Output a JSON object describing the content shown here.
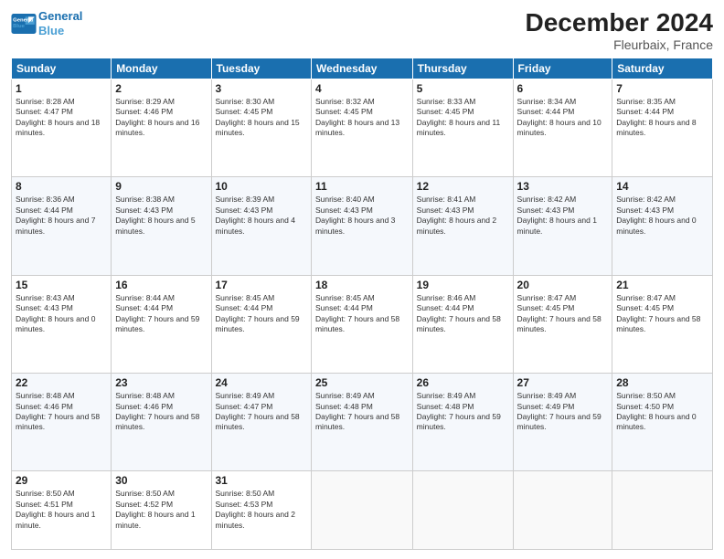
{
  "header": {
    "logo_line1": "General",
    "logo_line2": "Blue",
    "title": "December 2024",
    "subtitle": "Fleurbaix, France"
  },
  "columns": [
    "Sunday",
    "Monday",
    "Tuesday",
    "Wednesday",
    "Thursday",
    "Friday",
    "Saturday"
  ],
  "weeks": [
    [
      {
        "day": "1",
        "sunrise": "Sunrise: 8:28 AM",
        "sunset": "Sunset: 4:47 PM",
        "daylight": "Daylight: 8 hours and 18 minutes."
      },
      {
        "day": "2",
        "sunrise": "Sunrise: 8:29 AM",
        "sunset": "Sunset: 4:46 PM",
        "daylight": "Daylight: 8 hours and 16 minutes."
      },
      {
        "day": "3",
        "sunrise": "Sunrise: 8:30 AM",
        "sunset": "Sunset: 4:45 PM",
        "daylight": "Daylight: 8 hours and 15 minutes."
      },
      {
        "day": "4",
        "sunrise": "Sunrise: 8:32 AM",
        "sunset": "Sunset: 4:45 PM",
        "daylight": "Daylight: 8 hours and 13 minutes."
      },
      {
        "day": "5",
        "sunrise": "Sunrise: 8:33 AM",
        "sunset": "Sunset: 4:45 PM",
        "daylight": "Daylight: 8 hours and 11 minutes."
      },
      {
        "day": "6",
        "sunrise": "Sunrise: 8:34 AM",
        "sunset": "Sunset: 4:44 PM",
        "daylight": "Daylight: 8 hours and 10 minutes."
      },
      {
        "day": "7",
        "sunrise": "Sunrise: 8:35 AM",
        "sunset": "Sunset: 4:44 PM",
        "daylight": "Daylight: 8 hours and 8 minutes."
      }
    ],
    [
      {
        "day": "8",
        "sunrise": "Sunrise: 8:36 AM",
        "sunset": "Sunset: 4:44 PM",
        "daylight": "Daylight: 8 hours and 7 minutes."
      },
      {
        "day": "9",
        "sunrise": "Sunrise: 8:38 AM",
        "sunset": "Sunset: 4:43 PM",
        "daylight": "Daylight: 8 hours and 5 minutes."
      },
      {
        "day": "10",
        "sunrise": "Sunrise: 8:39 AM",
        "sunset": "Sunset: 4:43 PM",
        "daylight": "Daylight: 8 hours and 4 minutes."
      },
      {
        "day": "11",
        "sunrise": "Sunrise: 8:40 AM",
        "sunset": "Sunset: 4:43 PM",
        "daylight": "Daylight: 8 hours and 3 minutes."
      },
      {
        "day": "12",
        "sunrise": "Sunrise: 8:41 AM",
        "sunset": "Sunset: 4:43 PM",
        "daylight": "Daylight: 8 hours and 2 minutes."
      },
      {
        "day": "13",
        "sunrise": "Sunrise: 8:42 AM",
        "sunset": "Sunset: 4:43 PM",
        "daylight": "Daylight: 8 hours and 1 minute."
      },
      {
        "day": "14",
        "sunrise": "Sunrise: 8:42 AM",
        "sunset": "Sunset: 4:43 PM",
        "daylight": "Daylight: 8 hours and 0 minutes."
      }
    ],
    [
      {
        "day": "15",
        "sunrise": "Sunrise: 8:43 AM",
        "sunset": "Sunset: 4:43 PM",
        "daylight": "Daylight: 8 hours and 0 minutes."
      },
      {
        "day": "16",
        "sunrise": "Sunrise: 8:44 AM",
        "sunset": "Sunset: 4:44 PM",
        "daylight": "Daylight: 7 hours and 59 minutes."
      },
      {
        "day": "17",
        "sunrise": "Sunrise: 8:45 AM",
        "sunset": "Sunset: 4:44 PM",
        "daylight": "Daylight: 7 hours and 59 minutes."
      },
      {
        "day": "18",
        "sunrise": "Sunrise: 8:45 AM",
        "sunset": "Sunset: 4:44 PM",
        "daylight": "Daylight: 7 hours and 58 minutes."
      },
      {
        "day": "19",
        "sunrise": "Sunrise: 8:46 AM",
        "sunset": "Sunset: 4:44 PM",
        "daylight": "Daylight: 7 hours and 58 minutes."
      },
      {
        "day": "20",
        "sunrise": "Sunrise: 8:47 AM",
        "sunset": "Sunset: 4:45 PM",
        "daylight": "Daylight: 7 hours and 58 minutes."
      },
      {
        "day": "21",
        "sunrise": "Sunrise: 8:47 AM",
        "sunset": "Sunset: 4:45 PM",
        "daylight": "Daylight: 7 hours and 58 minutes."
      }
    ],
    [
      {
        "day": "22",
        "sunrise": "Sunrise: 8:48 AM",
        "sunset": "Sunset: 4:46 PM",
        "daylight": "Daylight: 7 hours and 58 minutes."
      },
      {
        "day": "23",
        "sunrise": "Sunrise: 8:48 AM",
        "sunset": "Sunset: 4:46 PM",
        "daylight": "Daylight: 7 hours and 58 minutes."
      },
      {
        "day": "24",
        "sunrise": "Sunrise: 8:49 AM",
        "sunset": "Sunset: 4:47 PM",
        "daylight": "Daylight: 7 hours and 58 minutes."
      },
      {
        "day": "25",
        "sunrise": "Sunrise: 8:49 AM",
        "sunset": "Sunset: 4:48 PM",
        "daylight": "Daylight: 7 hours and 58 minutes."
      },
      {
        "day": "26",
        "sunrise": "Sunrise: 8:49 AM",
        "sunset": "Sunset: 4:48 PM",
        "daylight": "Daylight: 7 hours and 59 minutes."
      },
      {
        "day": "27",
        "sunrise": "Sunrise: 8:49 AM",
        "sunset": "Sunset: 4:49 PM",
        "daylight": "Daylight: 7 hours and 59 minutes."
      },
      {
        "day": "28",
        "sunrise": "Sunrise: 8:50 AM",
        "sunset": "Sunset: 4:50 PM",
        "daylight": "Daylight: 8 hours and 0 minutes."
      }
    ],
    [
      {
        "day": "29",
        "sunrise": "Sunrise: 8:50 AM",
        "sunset": "Sunset: 4:51 PM",
        "daylight": "Daylight: 8 hours and 1 minute."
      },
      {
        "day": "30",
        "sunrise": "Sunrise: 8:50 AM",
        "sunset": "Sunset: 4:52 PM",
        "daylight": "Daylight: 8 hours and 1 minute."
      },
      {
        "day": "31",
        "sunrise": "Sunrise: 8:50 AM",
        "sunset": "Sunset: 4:53 PM",
        "daylight": "Daylight: 8 hours and 2 minutes."
      },
      null,
      null,
      null,
      null
    ]
  ]
}
